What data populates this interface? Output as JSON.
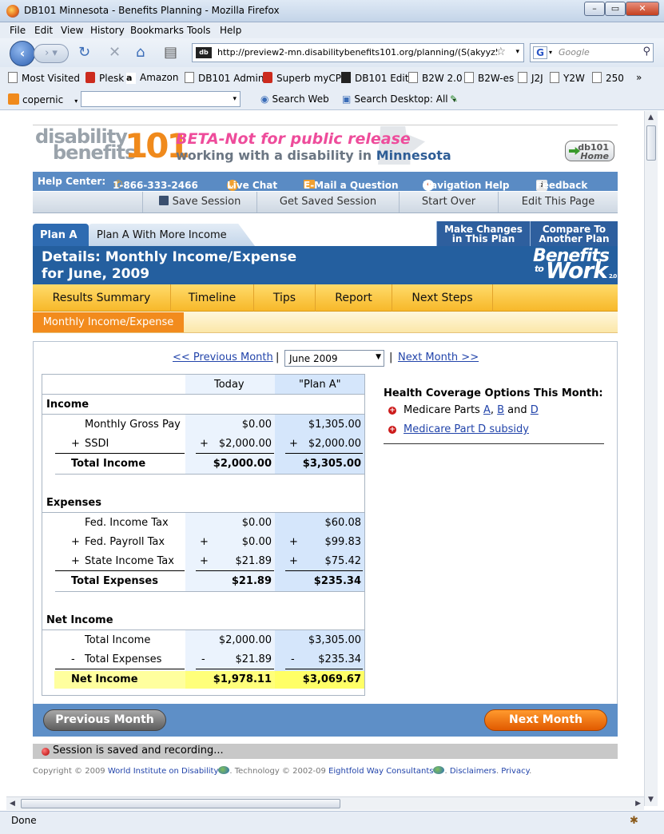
{
  "browser": {
    "window_title": "DB101 Minnesota - Benefits Planning - Mozilla Firefox",
    "menu": [
      "File",
      "Edit",
      "View",
      "History",
      "Bookmarks",
      "Tools",
      "Help"
    ],
    "url": "http://preview2-mn.disabilitybenefits101.org/planning/(S(akyyz5",
    "favicon_label": "db",
    "search_placeholder": "Google",
    "bookmarks": [
      "Most Visited",
      "Plesk",
      "Amazon",
      "DB101 Admin",
      "Superb myCP",
      "DB101 Edit",
      "B2W 2.0",
      "B2W-es",
      "J2J",
      "Y2W",
      "250"
    ],
    "toolbar3": {
      "copernic": "copernic",
      "search_web": "Search Web",
      "search_desktop": "Search Desktop: All"
    },
    "status": "Done"
  },
  "site": {
    "logo_line1": "disability",
    "logo_line2": "benefits",
    "logo_number": "101",
    "beta": "BETA-Not for public release",
    "tagline_prefix": "working with a disability in ",
    "tagline_state": "Minnesota",
    "home_badge_top": "db101",
    "home_badge_bottom": "Home"
  },
  "helpbar": {
    "label": "Help Center:",
    "phone": "1-866-333-2466",
    "chat": "Live Chat",
    "email": "E-Mail a Question",
    "nav_help": "Navigation Help",
    "feedback": "Feedback"
  },
  "session_bar": [
    "Save Session",
    "Get Saved Session",
    "Start Over",
    "Edit This Page"
  ],
  "plan_tabs": {
    "active": "Plan A",
    "other": "Plan A With More Income"
  },
  "plan_actions": {
    "make_changes": [
      "Make Changes",
      "in This Plan"
    ],
    "compare": [
      "Compare To",
      "Another Plan"
    ]
  },
  "detail_header": {
    "line1": "Details: Monthly Income/Expense",
    "line2": "for June, 2009",
    "b2w_1": "Benefits",
    "b2w_to": "to",
    "b2w_2": "Work",
    "b2w_ver": "2.0"
  },
  "subnav": [
    "Results Summary",
    "Timeline",
    "Tips",
    "Report",
    "Next Steps"
  ],
  "subsubnav_active": "Monthly Income/Expense",
  "month_nav": {
    "prev": "<< Previous Month",
    "sep1": "|",
    "selected": "June 2009",
    "sep2": "|",
    "next": "Next Month >>"
  },
  "table": {
    "col_today": "Today",
    "col_plan": "\"Plan A\"",
    "income_heading": "Income",
    "income_rows": [
      {
        "op": "",
        "label": "Monthly Gross Pay",
        "today_op": "",
        "today": "$0.00",
        "plan_op": "",
        "plan": "$1,305.00"
      },
      {
        "op": "+",
        "label": "SSDI",
        "today_op": "+",
        "today": "$2,000.00",
        "plan_op": "+",
        "plan": "$2,000.00"
      }
    ],
    "income_total": {
      "label": "Total Income",
      "today": "$2,000.00",
      "plan": "$3,305.00"
    },
    "expenses_heading": "Expenses",
    "expense_rows": [
      {
        "op": "",
        "label": "Fed. Income Tax",
        "today_op": "",
        "today": "$0.00",
        "plan_op": "",
        "plan": "$60.08"
      },
      {
        "op": "+",
        "label": "Fed. Payroll Tax",
        "today_op": "+",
        "today": "$0.00",
        "plan_op": "+",
        "plan": "$99.83"
      },
      {
        "op": "+",
        "label": "State Income Tax",
        "today_op": "+",
        "today": "$21.89",
        "plan_op": "+",
        "plan": "$75.42"
      }
    ],
    "expense_total": {
      "label": "Total Expenses",
      "today": "$21.89",
      "plan": "$235.34"
    },
    "net_heading": "Net Income",
    "net_rows": [
      {
        "op": "",
        "label": "Total Income",
        "today_op": "",
        "today": "$2,000.00",
        "plan_op": "",
        "plan": "$3,305.00"
      },
      {
        "op": "-",
        "label": "Total Expenses",
        "today_op": "-",
        "today": "$21.89",
        "plan_op": "-",
        "plan": "$235.34"
      }
    ],
    "net_total": {
      "label": "Net Income",
      "today": "$1,978.11",
      "plan": "$3,069.67"
    }
  },
  "health": {
    "title": "Health Coverage Options This Month:",
    "item1_prefix": "Medicare Parts ",
    "item1_links": [
      "A",
      "B",
      "D"
    ],
    "item1_sep1": ", ",
    "item1_sep2": " and ",
    "item2": "Medicare Part D subsidy"
  },
  "bottom_buttons": {
    "prev": "Previous Month",
    "next": "Next Month"
  },
  "recording": "Session is saved and recording...",
  "footer": {
    "copy1": "Copyright © 2009 ",
    "org": "World Institute on Disability",
    "tech": ". Technology © 2002-09 ",
    "tech_co": "Eightfold Way Consultants",
    "sep": ". ",
    "disclaimers": "Disclaimers",
    "privacy": "Privacy",
    "end": "."
  }
}
